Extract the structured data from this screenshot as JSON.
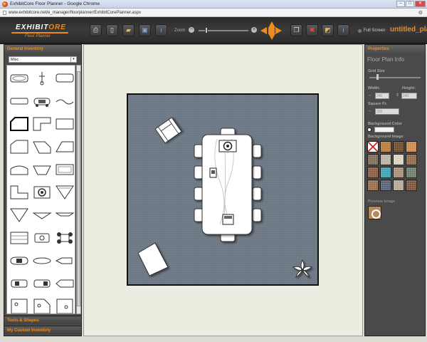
{
  "browser": {
    "window_title": "ExhibitCore Floor Planner - Google Chrome",
    "url": "www.exhibitcore.net/e_manager/floorplanner/ExhibitCorePlanner.aspx"
  },
  "logo": {
    "text": "EXHIBIT",
    "accent_text": "ORE",
    "subtitle": "Floor Planner"
  },
  "toolbar": {
    "zoom_label": "Zoom",
    "zoom_minus": "−",
    "zoom_plus": "+",
    "full_screen_label": "Full Screen",
    "document_title": "untitled_pla"
  },
  "left_panel": {
    "header": "General Inventory",
    "category_value": "Misc",
    "dropdown_arrow": "▾",
    "tools_section": "Tools & Shapes",
    "custom_section": "My Custom Inventory"
  },
  "right_panel": {
    "header": "Properties",
    "title": "Floor Plan Info",
    "grid_size_label": "Grid Size",
    "width_label": "Width:",
    "height_label": "Height:",
    "width_value": "240",
    "height_value": "240",
    "square_ft_label": "Square Ft.",
    "square_ft_value": "320",
    "bg_color_label": "Background Color",
    "bg_image_label": "Background Image",
    "preview_label": "Preview Image"
  },
  "bg_tiles": [
    "#ffffff",
    "#b77a3a",
    "#6e4a2c",
    "#c98a4a",
    "#7d6a58",
    "#b8b0a4",
    "#d9d0c2",
    "#8d6a45",
    "#8c5a3c",
    "#3aa2b4",
    "#a88e76",
    "#6c7b6a",
    "#9a6a4a",
    "#556074",
    "#b2a896",
    "#7a5238"
  ],
  "colors": {
    "accent": "#f08a1c",
    "panel": "#4a4a4a",
    "floor": "#6d7885",
    "canvas": "#edece1"
  }
}
